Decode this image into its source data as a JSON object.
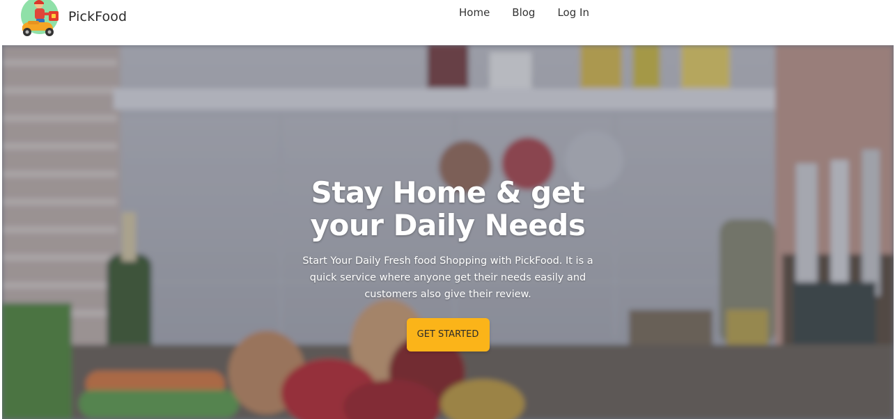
{
  "brand": {
    "name": "PickFood"
  },
  "nav": {
    "items": [
      {
        "label": "Home"
      },
      {
        "label": "Blog"
      },
      {
        "label": "Log In"
      }
    ]
  },
  "hero": {
    "title": "Stay Home & get your Daily Needs",
    "subtitle": "Start Your Daily Fresh food Shopping with PickFood. It is a quick service where anyone get their needs easily and customers also give their review.",
    "cta_label": "GET STARTED"
  },
  "colors": {
    "accent": "#fbb419",
    "text_dark": "#333333",
    "hero_text": "#ffffff"
  }
}
